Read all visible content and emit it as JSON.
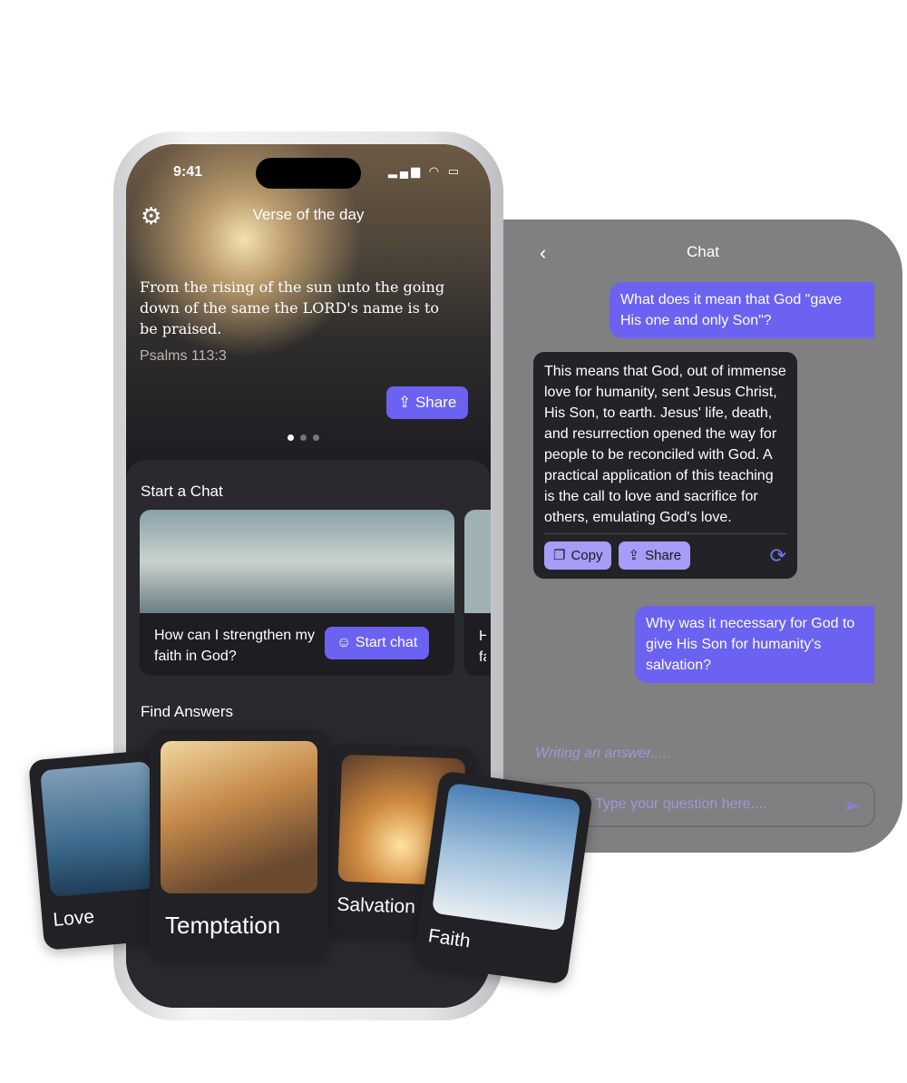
{
  "chat": {
    "title": "Chat",
    "back_icon": "chevron-left-icon",
    "messages": [
      {
        "role": "user",
        "text": "What does it mean that God \"gave His one and only Son\"?"
      },
      {
        "role": "assistant",
        "text": "This means that God, out of immense love for humanity, sent Jesus Christ, His Son, to earth. Jesus' life, death, and resurrection opened the way for people to be reconciled with God. A practical application of this teaching is the call to love and sacrifice for others, emulating God's love."
      },
      {
        "role": "user",
        "text": "Why was it necessary for God to give His Son for humanity's salvation?"
      }
    ],
    "copy_label": "Copy",
    "share_label": "Share",
    "status": "Writing an answer.....",
    "input_placeholder": "Type your question here...."
  },
  "phone": {
    "time": "9:41",
    "header_title": "Verse of the day",
    "verse": "From the rising of the sun unto the going down of the same the LORD's name is to be praised.",
    "reference": "Psalms 113:3",
    "share_label": "Share",
    "start_chat_heading": "Start a Chat",
    "chat_card": {
      "question": "How can I strengthen my faith in God?",
      "button": "Start chat"
    },
    "next_card_partial": "H fa",
    "find_answers_heading": "Find Answers"
  },
  "topics": [
    "Love",
    "Temptation",
    "Salvation",
    "Faith"
  ],
  "colors": {
    "accent": "#6b62f2",
    "accent_light": "#a59df7",
    "panel": "#808080",
    "dark": "#2a292e"
  }
}
